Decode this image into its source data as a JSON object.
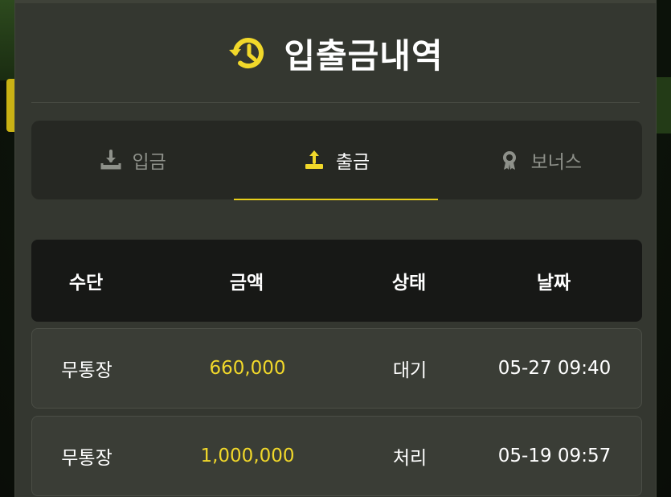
{
  "header": {
    "title": "입출금내역",
    "title_icon": "history-clock-icon"
  },
  "tabs": [
    {
      "label": "입금",
      "icon": "download-tray-icon",
      "active": false
    },
    {
      "label": "출금",
      "icon": "upload-tray-icon",
      "active": true
    },
    {
      "label": "보너스",
      "icon": "award-ribbon-icon",
      "active": false
    }
  ],
  "table": {
    "columns": [
      "수단",
      "금액",
      "상태",
      "날짜"
    ],
    "rows": [
      {
        "method": "무통장",
        "amount": "660,000",
        "status": "대기",
        "date": "05-27 09:40"
      },
      {
        "method": "무통장",
        "amount": "1,000,000",
        "status": "처리",
        "date": "05-19 09:57"
      }
    ]
  },
  "colors": {
    "accent": "#f1d82a",
    "panel": "#343730",
    "header_bg": "#171816"
  }
}
